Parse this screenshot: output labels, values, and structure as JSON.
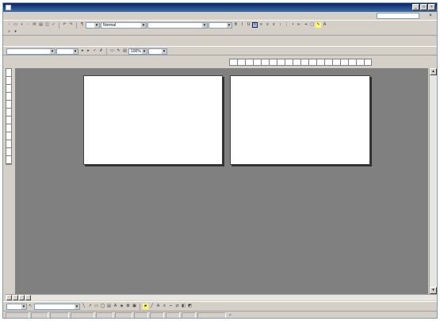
{
  "window": {
    "title": ""
  },
  "menu": {
    "items": [
      "",
      "",
      "",
      "",
      "",
      "",
      "",
      "",
      "",
      ""
    ]
  },
  "help": {
    "placeholder": ""
  },
  "toolbar1": {
    "style": "Normal",
    "font": "",
    "size": "",
    "zoom": "100%",
    "view": ""
  },
  "toolbar2": {
    "style": "",
    "mode": ""
  },
  "drawing": {
    "draw_label": "",
    "autoshapes_label": ""
  },
  "status": {
    "page": "",
    "sec": "",
    "pos": "",
    "at": "",
    "ln": "",
    "col": "",
    "lang": ""
  }
}
